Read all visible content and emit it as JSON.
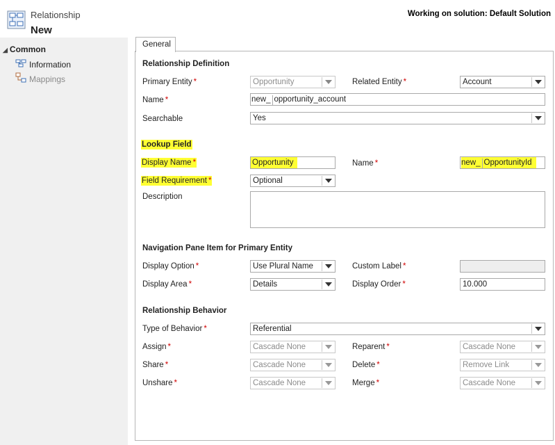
{
  "header": {
    "entity_type": "Relationship",
    "title": "New",
    "solution_text": "Working on solution: Default Solution"
  },
  "sidebar": {
    "group": "Common",
    "items": [
      {
        "label": "Information",
        "icon": "information-icon"
      },
      {
        "label": "Mappings",
        "icon": "mappings-icon"
      }
    ]
  },
  "tabs": [
    {
      "label": "General"
    }
  ],
  "relationship_definition": {
    "title": "Relationship Definition",
    "primary_entity_label": "Primary Entity",
    "primary_entity_value": "Opportunity",
    "related_entity_label": "Related Entity",
    "related_entity_value": "Account",
    "name_label": "Name",
    "name_prefix": "new_",
    "name_value": "opportunity_account",
    "searchable_label": "Searchable",
    "searchable_value": "Yes"
  },
  "lookup_field": {
    "title": "Lookup Field",
    "display_name_label": "Display Name",
    "display_name_value": "Opportunity",
    "name_label": "Name",
    "name_prefix": "new_",
    "name_value": "OpportunityId",
    "field_requirement_label": "Field Requirement",
    "field_requirement_value": "Optional",
    "description_label": "Description",
    "description_value": ""
  },
  "navigation_pane": {
    "title": "Navigation Pane Item for Primary Entity",
    "display_option_label": "Display Option",
    "display_option_value": "Use Plural Name",
    "custom_label_label": "Custom Label",
    "custom_label_value": "",
    "display_area_label": "Display Area",
    "display_area_value": "Details",
    "display_order_label": "Display Order",
    "display_order_value": "10.000"
  },
  "relationship_behavior": {
    "title": "Relationship Behavior",
    "type_label": "Type of Behavior",
    "type_value": "Referential",
    "assign_label": "Assign",
    "assign_value": "Cascade None",
    "reparent_label": "Reparent",
    "reparent_value": "Cascade None",
    "share_label": "Share",
    "share_value": "Cascade None",
    "delete_label": "Delete",
    "delete_value": "Remove Link",
    "unshare_label": "Unshare",
    "unshare_value": "Cascade None",
    "merge_label": "Merge",
    "merge_value": "Cascade None"
  },
  "required_marker": "*",
  "colors": {
    "highlight": "#ffff33",
    "required": "#d00000",
    "sidebar_bg": "#f0f0f0",
    "disabled_text": "#8c8c8c"
  }
}
